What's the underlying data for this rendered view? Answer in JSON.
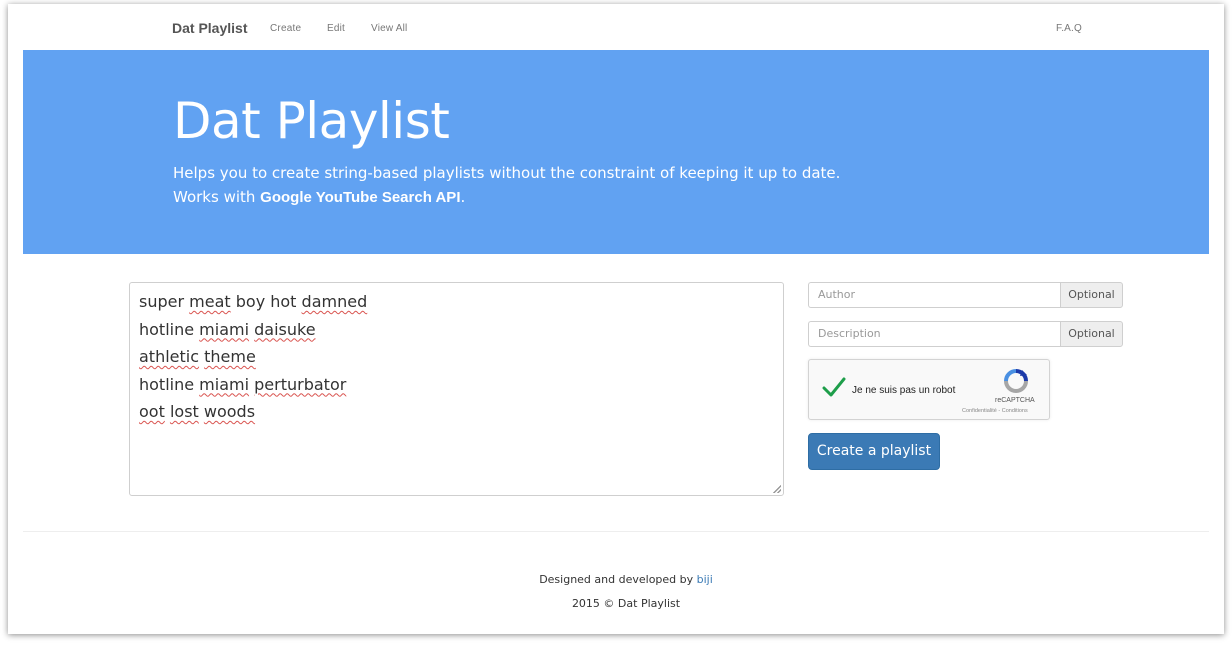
{
  "navbar": {
    "brand": "Dat Playlist",
    "links": [
      "Create",
      "Edit",
      "View All"
    ],
    "faq": "F.A.Q"
  },
  "jumbotron": {
    "title": "Dat Playlist",
    "line1": "Helps you to create string-based playlists without the constraint of keeping it up to date.",
    "line2_prefix": "Works with ",
    "line2_bold": "Google YouTube Search API",
    "line2_suffix": "."
  },
  "playlist": {
    "lines": [
      [
        "super ",
        "meat",
        " boy hot ",
        "damned",
        ""
      ],
      [
        "hotline ",
        "miami",
        " ",
        "daisuke",
        ""
      ],
      [
        "",
        "athletic",
        " ",
        "theme",
        ""
      ],
      [
        "hotline ",
        "miami",
        " ",
        "perturbator",
        ""
      ],
      [
        "",
        "oot",
        " ",
        "lost",
        " ",
        "woods"
      ]
    ]
  },
  "form": {
    "author_placeholder": "Author",
    "author_addon": "Optional",
    "description_placeholder": "Description",
    "description_addon": "Optional",
    "submit_label": "Create a playlist"
  },
  "recaptcha": {
    "label": "Je ne suis pas un robot",
    "brand": "reCAPTCHA",
    "links": "Confidentialité - Conditions",
    "check_color": "#1e9e4a"
  },
  "footer": {
    "credit_prefix": "Designed and developed by ",
    "credit_author": "biji",
    "copyright": "2015 © Dat Playlist"
  },
  "colors": {
    "jumbotron_bg": "#61a2f2",
    "button_bg": "#3b7ab5",
    "link": "#3b7ab5"
  }
}
